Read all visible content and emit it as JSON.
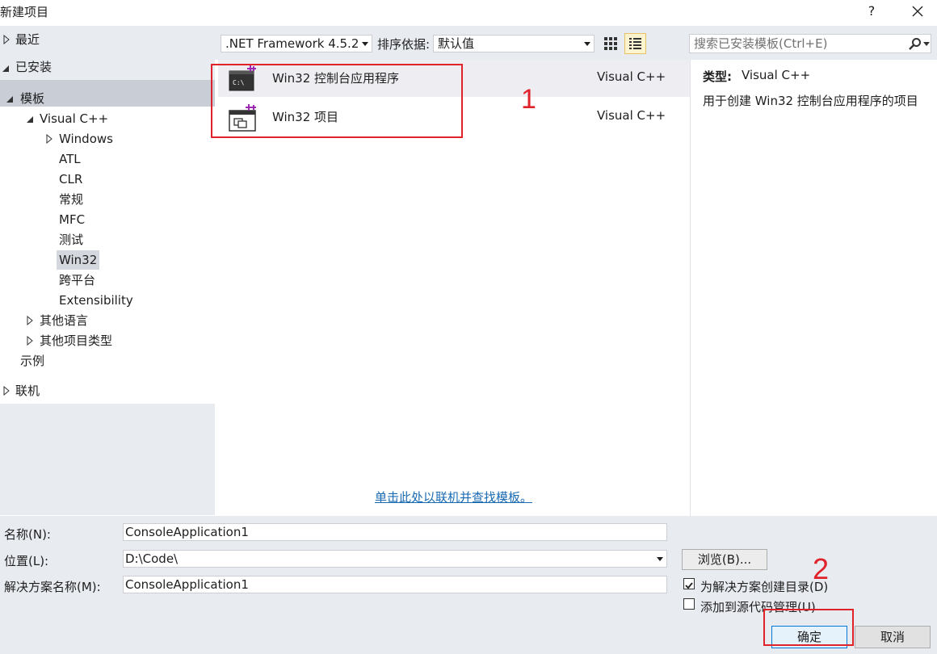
{
  "window": {
    "title": "新建项目",
    "help_label": "?"
  },
  "tree": {
    "recent": "最近",
    "installed": "已安装",
    "templates": "模板",
    "visual_cpp": "Visual C++",
    "windows": "Windows",
    "atl": "ATL",
    "clr": "CLR",
    "general": "常规",
    "mfc": "MFC",
    "test": "测试",
    "win32": "Win32",
    "cross_platform": "跨平台",
    "extensibility": "Extensibility",
    "other_languages": "其他语言",
    "other_project_types": "其他项目类型",
    "samples": "示例",
    "online": "联机"
  },
  "toolbar": {
    "framework": ".NET Framework 4.5.2",
    "sort_label": "排序依据:",
    "sort_value": "默认值",
    "search_placeholder": "搜索已安装模板(Ctrl+E)"
  },
  "templates": [
    {
      "name": "Win32 控制台应用程序",
      "lang": "Visual C++",
      "selected": true
    },
    {
      "name": "Win32 项目",
      "lang": "Visual C++",
      "selected": false
    }
  ],
  "online_link": "单击此处以联机并查找模板。",
  "description": {
    "type_label": "类型:",
    "type_value": "Visual C++",
    "text": "用于创建 Win32 控制台应用程序的项目"
  },
  "form": {
    "name_label": "名称(N):",
    "name_value": "ConsoleApplication1",
    "location_label": "位置(L):",
    "location_value": "D:\\Code\\",
    "solution_label": "解决方案名称(M):",
    "solution_value": "ConsoleApplication1",
    "browse_label": "浏览(B)...",
    "create_dir_label": "为解决方案创建目录(D)",
    "create_dir_checked": true,
    "source_control_label": "添加到源代码管理(U)",
    "source_control_checked": false,
    "ok_label": "确定",
    "cancel_label": "取消"
  },
  "annotations": {
    "note_1": "1",
    "note_2": "2",
    "color": "#e0222a"
  }
}
